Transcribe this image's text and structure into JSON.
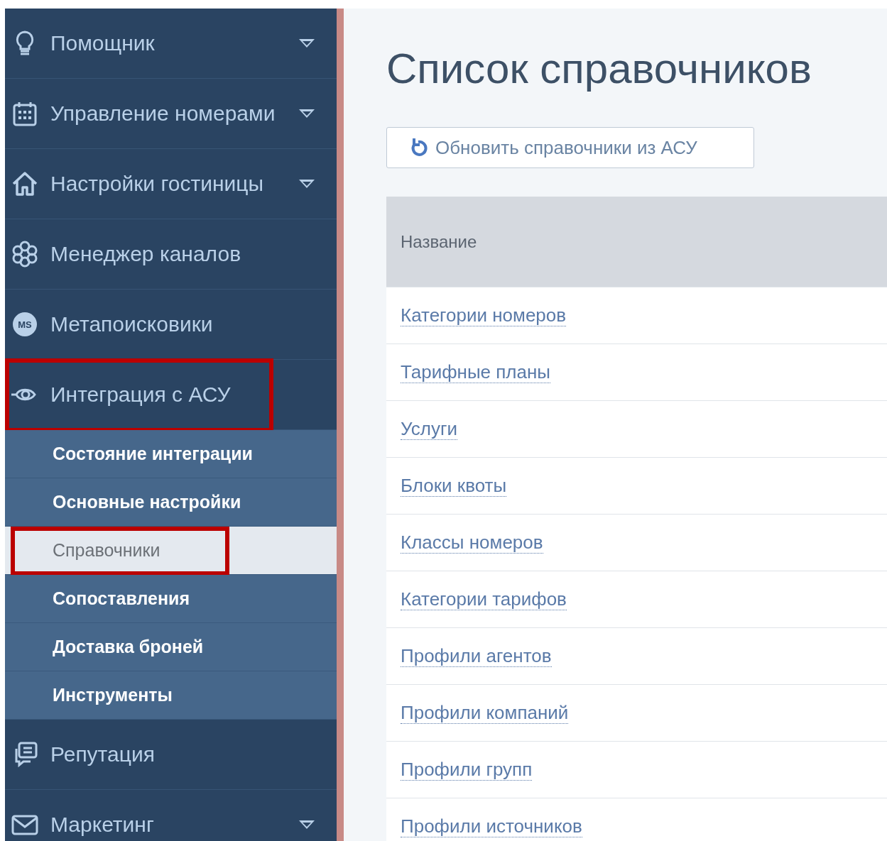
{
  "sidebar": {
    "items": [
      {
        "label": "Помощник",
        "expandable": true,
        "highlighted": false
      },
      {
        "label": "Управление номерами",
        "expandable": true,
        "highlighted": false
      },
      {
        "label": "Настройки гостиницы",
        "expandable": true,
        "highlighted": false
      },
      {
        "label": "Менеджер каналов",
        "expandable": false,
        "highlighted": false
      },
      {
        "label": "Метапоисковики",
        "icon_text": "MS",
        "expandable": false,
        "highlighted": false
      },
      {
        "label": "Интеграция с АСУ",
        "expandable": false,
        "highlighted": true,
        "children": [
          {
            "label": "Состояние интеграции",
            "selected": false,
            "highlighted": false
          },
          {
            "label": "Основные настройки",
            "selected": false,
            "highlighted": false
          },
          {
            "label": "Справочники",
            "selected": true,
            "highlighted": true
          },
          {
            "label": "Сопоставления",
            "selected": false,
            "highlighted": false
          },
          {
            "label": "Доставка броней",
            "selected": false,
            "highlighted": false
          },
          {
            "label": "Инструменты",
            "selected": false,
            "highlighted": false
          }
        ]
      },
      {
        "label": "Репутация",
        "expandable": false,
        "highlighted": false
      },
      {
        "label": "Маркетинг",
        "expandable": true,
        "highlighted": false
      }
    ]
  },
  "main": {
    "title": "Список справочников",
    "refresh_button": "Обновить справочники из АСУ",
    "table": {
      "columns": [
        "Название"
      ],
      "rows": [
        "Категории номеров",
        "Тарифные планы",
        "Услуги",
        "Блоки квоты",
        "Классы номеров",
        "Категории тарифов",
        "Профили агентов",
        "Профили компаний",
        "Профили групп",
        "Профили источников"
      ]
    }
  }
}
